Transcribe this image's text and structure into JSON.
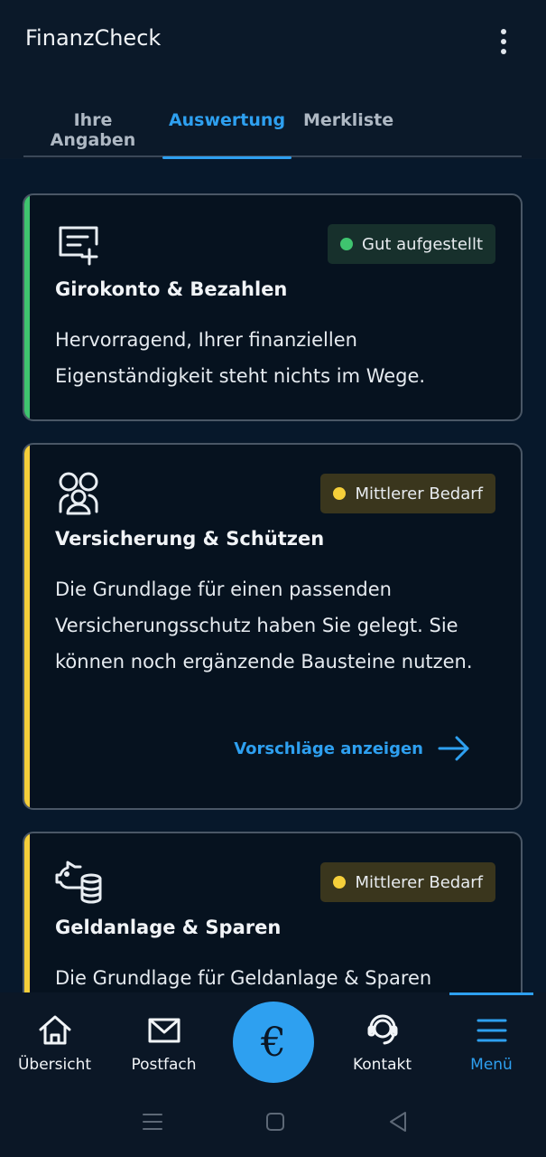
{
  "app": {
    "title": "FinanzCheck"
  },
  "tabs": [
    {
      "label": "Ihre Angaben"
    },
    {
      "label": "Auswertung"
    },
    {
      "label": "Merkliste"
    }
  ],
  "cards": [
    {
      "icon": "form-add-icon",
      "status": "Gut aufgestellt",
      "status_color": "#3fc46f",
      "title": "Girokonto & Bezahlen",
      "text": "Hervorragend, Ihrer finanziellen Eigenständigkeit steht nichts im Wege."
    },
    {
      "icon": "people-icon",
      "status": "Mittlerer Bedarf",
      "status_color": "#f5cf3a",
      "title": "Versicherung & Schützen",
      "text": "Die Grundlage für einen passenden Versicherungsschutz haben Sie gelegt. Sie können noch ergänzende Bausteine nutzen.",
      "link": "Vorschläge anzeigen"
    },
    {
      "icon": "piggy-bank-icon",
      "status": "Mittlerer Bedarf",
      "status_color": "#f5cf3a",
      "title": "Geldanlage & Sparen",
      "text": "Die Grundlage für Geldanlage & Sparen"
    }
  ],
  "bottom_nav": [
    {
      "label": "Übersicht",
      "icon": "home-icon"
    },
    {
      "label": "Postfach",
      "icon": "mail-icon"
    },
    {
      "label": "€",
      "icon": "euro-icon"
    },
    {
      "label": "Kontakt",
      "icon": "headset-icon"
    },
    {
      "label": "Menü",
      "icon": "menu-icon"
    }
  ],
  "colors": {
    "accent": "#2ea0f0",
    "background": "#07182b",
    "success": "#3fc46f",
    "warning": "#f5cf3a"
  }
}
